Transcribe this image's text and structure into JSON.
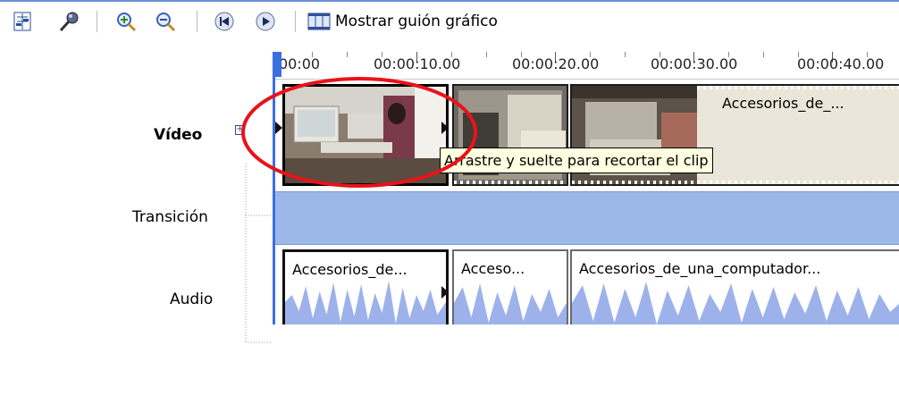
{
  "toolbar": {
    "buttons": [
      {
        "name": "set-audio-levels",
        "icon": "audio-levels-icon"
      },
      {
        "name": "narrate-timeline",
        "icon": "microphone-icon"
      },
      {
        "name": "zoom-in",
        "icon": "zoom-in-icon"
      },
      {
        "name": "zoom-out",
        "icon": "zoom-out-icon"
      },
      {
        "name": "rewind-timeline",
        "icon": "rewind-icon"
      },
      {
        "name": "play-timeline",
        "icon": "play-icon"
      }
    ],
    "storyboard_label": "Mostrar guión gráfico",
    "storyboard_icon": "storyboard-icon"
  },
  "tracks": {
    "video_label": "Vídeo",
    "transition_label": "Transición",
    "audio_label": "Audio"
  },
  "ruler": {
    "labels": [
      "00:00",
      "00:00:10.00",
      "00:00:20.00",
      "00:00:30.00",
      "00:00:40.00"
    ]
  },
  "video_clips": [
    {
      "title": ""
    },
    {
      "title": ""
    },
    {
      "title": "Accesorios_de_..."
    }
  ],
  "audio_clips": [
    {
      "title": "Accesorios_de..."
    },
    {
      "title": "Acceso..."
    },
    {
      "title": "Accesorios_de_una_computador..."
    }
  ],
  "tooltip": "Arrastre y suelte para recortar el clip",
  "colors": {
    "accent": "#3a6fe0",
    "transition_track": "#9cb8e9",
    "waveform": "#9db2ea",
    "annotation": "#e8131b",
    "tooltip_bg": "#ffffe1"
  }
}
